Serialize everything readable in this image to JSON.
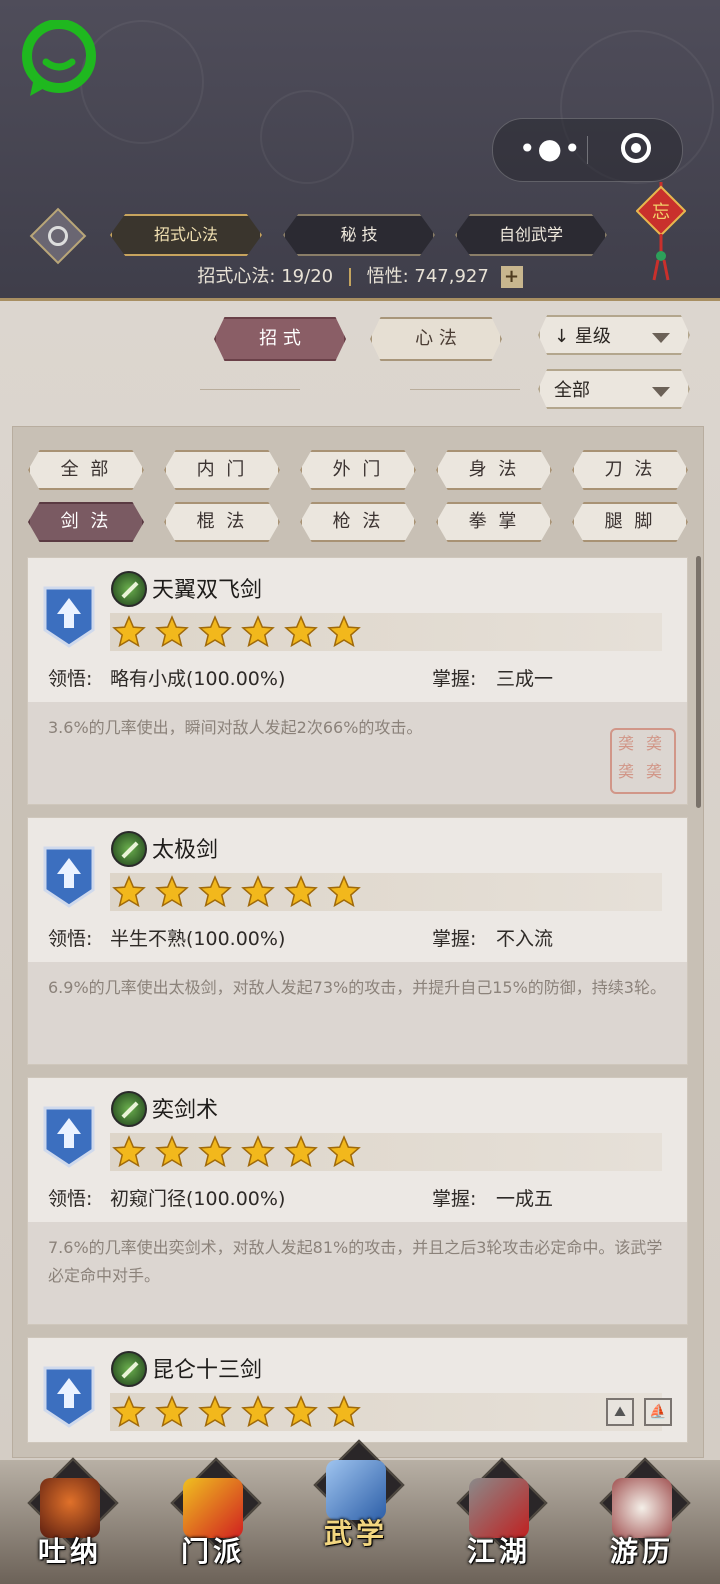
{
  "header": {
    "tabs": [
      {
        "label": "招式心法",
        "active": true
      },
      {
        "label": "秘 技",
        "active": false
      },
      {
        "label": "自创武学",
        "active": false
      }
    ],
    "charm_char": "忘",
    "stats": {
      "moves_label": "招式心法:",
      "moves_value": "19/20",
      "insight_label": "悟性:",
      "insight_value": "747,927",
      "plus": "+"
    }
  },
  "toggles": {
    "moves": "招 式",
    "methods": "心 法",
    "sort_label": "星级",
    "sort_arrow": "↓",
    "scope_label": "全部"
  },
  "filters": [
    "全 部",
    "内 门",
    "外 门",
    "身 法",
    "刀 法",
    "剑 法",
    "棍 法",
    "枪 法",
    "拳 掌",
    "腿 脚"
  ],
  "active_filter": "剑 法",
  "labels": {
    "comprehension": "领悟:",
    "mastery": "掌握:"
  },
  "skills": [
    {
      "name": "天翼双飞剑",
      "stars": 6,
      "comprehension": "略有小成(100.00%)",
      "mastery": "三成一",
      "desc": "3.6%的几率使出，瞬间对敌人发起2次66%的攻击。"
    },
    {
      "name": "太极剑",
      "stars": 6,
      "comprehension": "半生不熟(100.00%)",
      "mastery": "不入流",
      "desc": "6.9%的几率使出太极剑，对敌人发起73%的攻击，并提升自己15%的防御，持续3轮。"
    },
    {
      "name": "奕剑术",
      "stars": 6,
      "comprehension": "初窥门径(100.00%)",
      "mastery": "一成五",
      "desc": "7.6%的几率使出奕剑术，对敌人发起81%的攻击，并且之后3轮攻击必定命中。该武学必定命中对手。"
    },
    {
      "name": "昆仑十三剑",
      "stars": 6
    }
  ],
  "bottom_nav": [
    {
      "label": "吐纳",
      "active": false
    },
    {
      "label": "门派",
      "active": false
    },
    {
      "label": "武学",
      "active": true
    },
    {
      "label": "江湖",
      "active": false
    },
    {
      "label": "游历",
      "active": false
    }
  ],
  "colors": {
    "header_bg": "#4a4856",
    "active_pill": "#8a5e66",
    "star": "#f2b81c",
    "badge_blue": "#3c6fbf",
    "chat_green": "#1fb81f"
  }
}
